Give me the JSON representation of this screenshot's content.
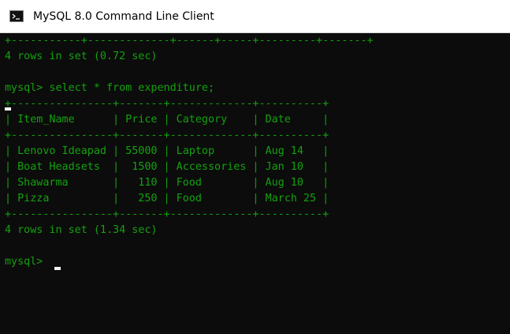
{
  "window": {
    "title": "MySQL 8.0 Command Line Client"
  },
  "console": {
    "lines": [
      "+-----------+-------------+------+-----+---------+-------+",
      "4 rows in set (0.72 sec)",
      "",
      "mysql> select * from expenditure;",
      "+----------------+-------+-------------+----------+",
      "| Item_Name      | Price | Category    | Date     |",
      "+----------------+-------+-------------+----------+",
      "| Lenovo Ideapad | 55000 | Laptop      | Aug 14   |",
      "| Boat Headsets  |  1500 | Accessories | Jan 10   |",
      "| Shawarma       |   110 | Food        | Aug 10   |",
      "| Pizza          |   250 | Food        | March 25 |",
      "+----------------+-------+-------------+----------+",
      "4 rows in set (1.34 sec)",
      "",
      "mysql> "
    ]
  },
  "icons": {
    "app_icon": "terminal-icon",
    "cursor": "text-cursor"
  },
  "colors": {
    "titlebar_bg": "#ffffff",
    "console_bg": "#0c0c0c",
    "console_text": "#13a10e",
    "cursor": "#f2f2f2"
  }
}
